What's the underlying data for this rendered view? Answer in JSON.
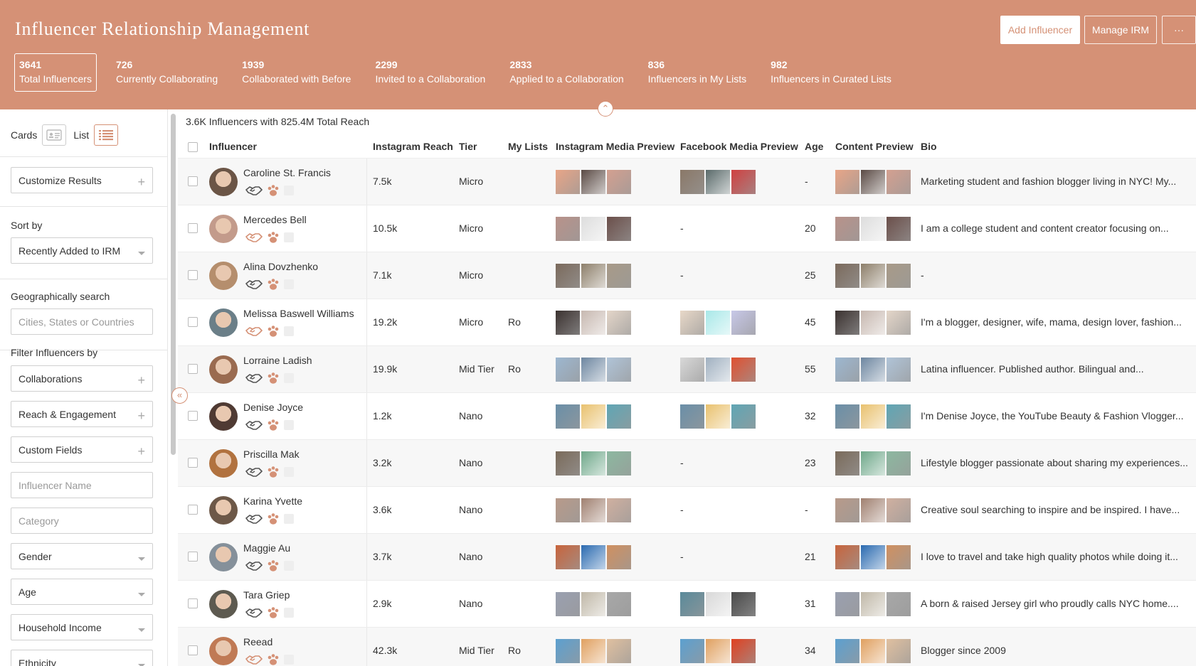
{
  "header": {
    "title": "Influencer Relationship Management",
    "add_button": "Add Influencer",
    "manage_button": "Manage IRM",
    "more_button": "···",
    "stats": [
      {
        "num": "3641",
        "label": "Total Influencers"
      },
      {
        "num": "726",
        "label": "Currently Collaborating"
      },
      {
        "num": "1939",
        "label": "Collaborated with Before"
      },
      {
        "num": "2299",
        "label": "Invited to a Collaboration"
      },
      {
        "num": "2833",
        "label": "Applied to a Collaboration"
      },
      {
        "num": "836",
        "label": "Influencers in My Lists"
      },
      {
        "num": "982",
        "label": "Influencers in Curated Lists"
      }
    ]
  },
  "sidebar": {
    "cards_label": "Cards",
    "list_label": "List",
    "customize": "Customize Results",
    "sort_label": "Sort by",
    "sort_value": "Recently Added to IRM",
    "geo_label": "Geographically search",
    "geo_placeholder": "Cities, States or Countries",
    "filter_label": "Filter Influencers by",
    "filters": {
      "collaborations": "Collaborations",
      "reach": "Reach & Engagement",
      "custom": "Custom Fields",
      "name": "Influencer Name",
      "category": "Category",
      "gender": "Gender",
      "age": "Age",
      "income": "Household Income",
      "ethnicity": "Ethnicity"
    }
  },
  "main": {
    "summary": "3.6K Influencers with 825.4M Total Reach",
    "columns": {
      "influencer": "Influencer",
      "reach": "Instagram Reach",
      "tier": "Tier",
      "lists": "My Lists",
      "ig": "Instagram Media Preview",
      "fb": "Facebook Media Preview",
      "age": "Age",
      "content": "Content Preview",
      "bio": "Bio"
    },
    "rows": [
      {
        "name": "Caroline St. Francis",
        "reach": "7.5k",
        "tier": "Micro",
        "lists": "",
        "fb": "",
        "age": "-",
        "bio": "Marketing student and fashion blogger living in NYC! My..."
      },
      {
        "name": "Mercedes Bell",
        "reach": "10.5k",
        "tier": "Micro",
        "lists": "",
        "fb": "-",
        "age": "20",
        "bio": "I am a college student and content creator focusing on..."
      },
      {
        "name": "Alina Dovzhenko",
        "reach": "7.1k",
        "tier": "Micro",
        "lists": "",
        "fb": "-",
        "age": "25",
        "bio": "-"
      },
      {
        "name": "Melissa Baswell Williams",
        "reach": "19.2k",
        "tier": "Micro",
        "lists": "Ro",
        "fb": "",
        "age": "45",
        "bio": "I'm a blogger, designer, wife, mama, design lover, fashion..."
      },
      {
        "name": "Lorraine Ladish",
        "reach": "19.9k",
        "tier": "Mid Tier",
        "lists": "Ro",
        "fb": "",
        "age": "55",
        "bio": "Latina influencer. Published author. Bilingual and..."
      },
      {
        "name": "Denise Joyce",
        "reach": "1.2k",
        "tier": "Nano",
        "lists": "",
        "fb": "",
        "age": "32",
        "bio": "I'm Denise Joyce, the YouTube Beauty & Fashion Vlogger..."
      },
      {
        "name": "Priscilla Mak",
        "reach": "3.2k",
        "tier": "Nano",
        "lists": "",
        "fb": "-",
        "age": "23",
        "bio": "Lifestyle blogger passionate about sharing my experiences..."
      },
      {
        "name": "Karina Yvette",
        "reach": "3.6k",
        "tier": "Nano",
        "lists": "",
        "fb": "-",
        "age": "-",
        "bio": "Creative soul searching to inspire and be inspired. I have..."
      },
      {
        "name": "Maggie Au",
        "reach": "3.7k",
        "tier": "Nano",
        "lists": "",
        "fb": "-",
        "age": "21",
        "bio": "I love to travel and take high quality photos while doing it..."
      },
      {
        "name": "Tara Griep",
        "reach": "2.9k",
        "tier": "Nano",
        "lists": "",
        "fb": "",
        "age": "31",
        "bio": "A born & raised Jersey girl who proudly calls NYC home...."
      },
      {
        "name": "Reead",
        "reach": "42.3k",
        "tier": "Mid Tier",
        "lists": "Ro",
        "fb": "",
        "age": "34",
        "bio": "Blogger since 2009"
      }
    ]
  },
  "colors": {
    "brand": "#d59176",
    "row_alt": "#f7f7f7"
  }
}
